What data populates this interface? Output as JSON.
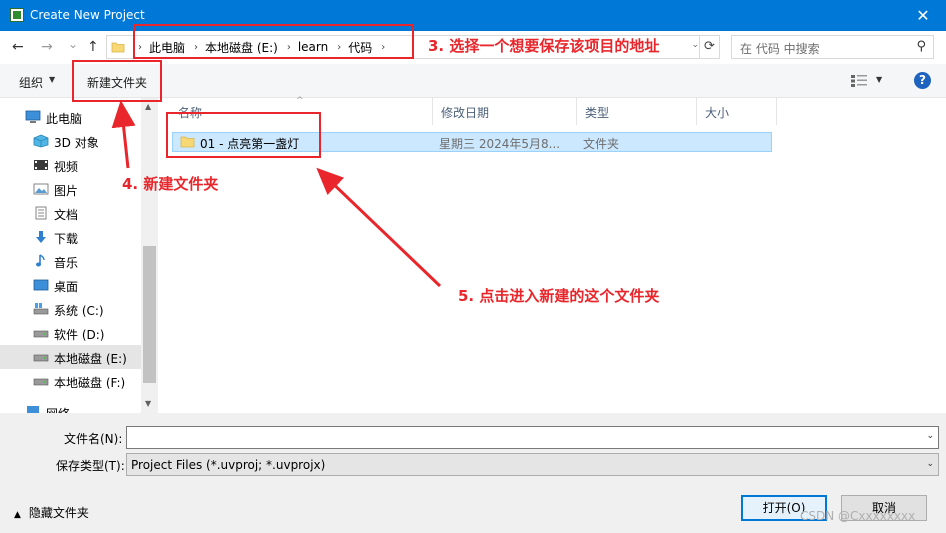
{
  "window": {
    "title": "Create New Project",
    "close_glyph": "✕"
  },
  "nav": {
    "back_glyph": "←",
    "forward_glyph": "→",
    "recent_glyph": "⌄",
    "up_glyph": "↑",
    "breadcrumbs": [
      "此电脑",
      "本地磁盘 (E:)",
      "learn",
      "代码"
    ],
    "crumb_sep": "›",
    "dropdown_glyph": "⌄",
    "refresh_glyph": "⟳",
    "search_placeholder": "在 代码 中搜索",
    "search_glyph": "⚲"
  },
  "toolbar": {
    "organize_label": "组织",
    "dropdown_glyph": "▼",
    "new_folder_label": "新建文件夹",
    "help_glyph": "?"
  },
  "sidebar": {
    "items": [
      {
        "label": "此电脑",
        "icon": "computer-icon"
      },
      {
        "label": "3D 对象",
        "icon": "3d-objects-icon"
      },
      {
        "label": "视频",
        "icon": "video-icon"
      },
      {
        "label": "图片",
        "icon": "pictures-icon"
      },
      {
        "label": "文档",
        "icon": "documents-icon"
      },
      {
        "label": "下载",
        "icon": "download-icon"
      },
      {
        "label": "音乐",
        "icon": "music-icon"
      },
      {
        "label": "桌面",
        "icon": "desktop-icon"
      },
      {
        "label": "系统 (C:)",
        "icon": "drive-icon"
      },
      {
        "label": "软件 (D:)",
        "icon": "drive-icon"
      },
      {
        "label": "本地磁盘 (E:)",
        "icon": "drive-icon",
        "selected": true
      },
      {
        "label": "本地磁盘 (F:)",
        "icon": "drive-icon"
      },
      {
        "label": "网络",
        "icon": "network-icon"
      }
    ],
    "scroll_up_glyph": "▲",
    "scroll_down_glyph": "▼"
  },
  "file_list": {
    "sort_glyph": "^",
    "columns": [
      "名称",
      "修改日期",
      "类型",
      "大小"
    ],
    "rows": [
      {
        "name": "01 - 点亮第一盏灯",
        "modified": "星期三  2024年5月8...",
        "type": "文件夹",
        "size": ""
      }
    ]
  },
  "bottom": {
    "filename_label": "文件名(N):",
    "filename_value": "",
    "filetype_label": "保存类型(T):",
    "filetype_value": "Project Files (*.uvproj; *.uvprojx)",
    "dropdown_glyph": "⌄",
    "hide_folders_label": "隐藏文件夹",
    "hide_folders_glyph": "▲",
    "open_label": "打开(O)",
    "cancel_label": "取消",
    "watermark": "CSDN @Cxxxxxxxx"
  },
  "annotations": {
    "step3": "3. 选择一个想要保存该项目的地址",
    "step4": "4. 新建文件夹",
    "step5": "5. 点击进入新建的这个文件夹",
    "color": "#e8262b"
  },
  "colors": {
    "titlebar": "#0078d7",
    "selection": "#cce8ff",
    "folder": "#f8d775"
  }
}
